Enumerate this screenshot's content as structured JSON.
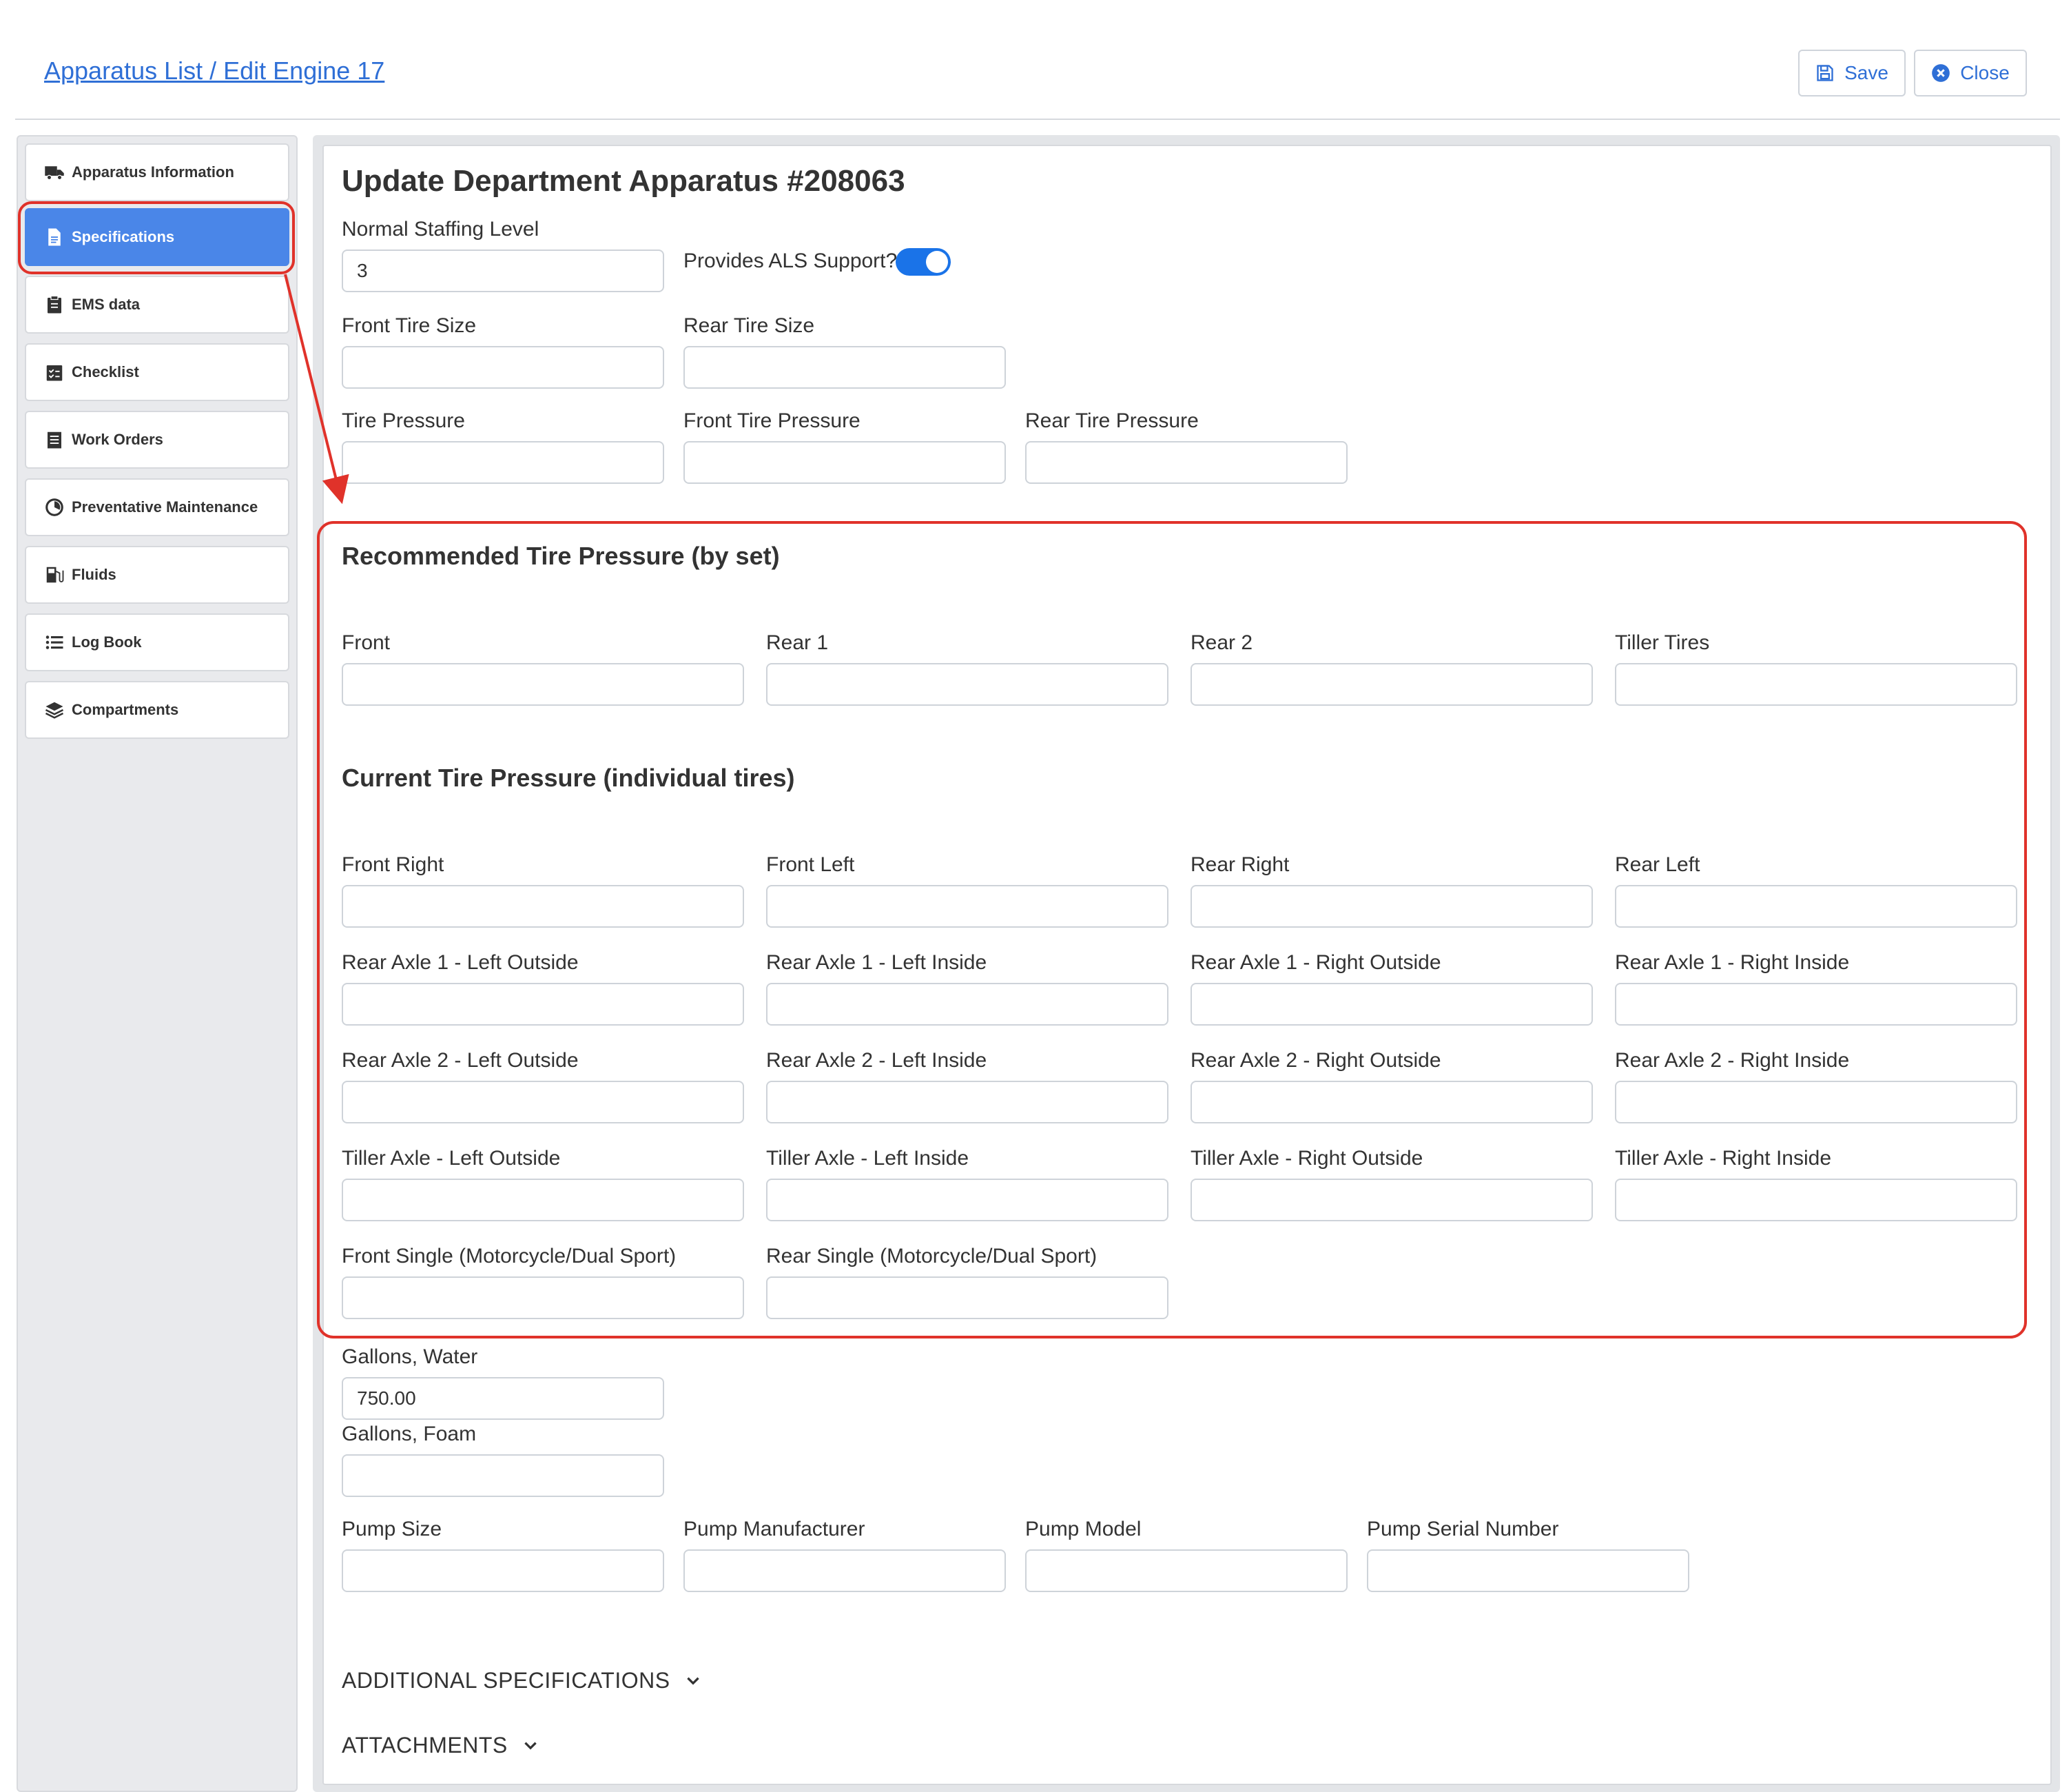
{
  "header": {
    "breadcrumb": "Apparatus List / Edit Engine 17",
    "save_label": "Save",
    "close_label": "Close"
  },
  "sidebar": {
    "items": [
      {
        "label": "Apparatus Information",
        "icon": "truck-icon"
      },
      {
        "label": "Specifications",
        "icon": "file-icon",
        "active": true
      },
      {
        "label": "EMS data",
        "icon": "clipboard-icon"
      },
      {
        "label": "Checklist",
        "icon": "checklist-icon"
      },
      {
        "label": "Work Orders",
        "icon": "list-alt-icon"
      },
      {
        "label": "Preventative Maintenance",
        "icon": "gauge-icon"
      },
      {
        "label": "Fluids",
        "icon": "gas-pump-icon"
      },
      {
        "label": "Log Book",
        "icon": "list-icon"
      },
      {
        "label": "Compartments",
        "icon": "layers-icon"
      }
    ]
  },
  "main": {
    "title": "Update Department Apparatus #208063",
    "staffing": {
      "label": "Normal Staffing Level",
      "value": "3"
    },
    "als": {
      "label": "Provides ALS Support?",
      "enabled": true
    },
    "front_tire_size": {
      "label": "Front Tire Size",
      "value": ""
    },
    "rear_tire_size": {
      "label": "Rear Tire Size",
      "value": ""
    },
    "tire_pressure": {
      "label": "Tire Pressure",
      "value": ""
    },
    "front_tire_pressure": {
      "label": "Front Tire Pressure",
      "value": ""
    },
    "rear_tire_pressure": {
      "label": "Rear Tire Pressure",
      "value": ""
    },
    "recommended": {
      "title": "Recommended Tire Pressure (by set)",
      "fields": [
        "Front",
        "Rear 1",
        "Rear 2",
        "Tiller Tires"
      ]
    },
    "current": {
      "title": "Current Tire Pressure (individual tires)",
      "rows": [
        [
          "Front Right",
          "Front Left",
          "Rear Right",
          "Rear Left"
        ],
        [
          "Rear Axle 1 - Left Outside",
          "Rear Axle 1 - Left Inside",
          "Rear Axle 1 - Right Outside",
          "Rear Axle 1 - Right Inside"
        ],
        [
          "Rear Axle 2 - Left Outside",
          "Rear Axle 2 - Left Inside",
          "Rear Axle 2 - Right Outside",
          "Rear Axle 2 - Right Inside"
        ],
        [
          "Tiller Axle - Left Outside",
          "Tiller Axle - Left Inside",
          "Tiller Axle - Right Outside",
          "Tiller Axle - Right Inside"
        ],
        [
          "Front Single (Motorcycle/Dual Sport)",
          "Rear Single (Motorcycle/Dual Sport)"
        ]
      ]
    },
    "gallons_water": {
      "label": "Gallons, Water",
      "value": "750.00"
    },
    "gallons_foam": {
      "label": "Gallons, Foam",
      "value": ""
    },
    "pump": {
      "size_label": "Pump Size",
      "manufacturer_label": "Pump Manufacturer",
      "model_label": "Pump Model",
      "serial_label": "Pump Serial Number"
    },
    "additional_specifications": "ADDITIONAL SPECIFICATIONS",
    "attachments": "ATTACHMENTS"
  },
  "colors": {
    "accent": "#4a86e8",
    "link": "#2f6fd6",
    "annotation": "#e0322a",
    "toggle_on": "#1a73e8"
  }
}
